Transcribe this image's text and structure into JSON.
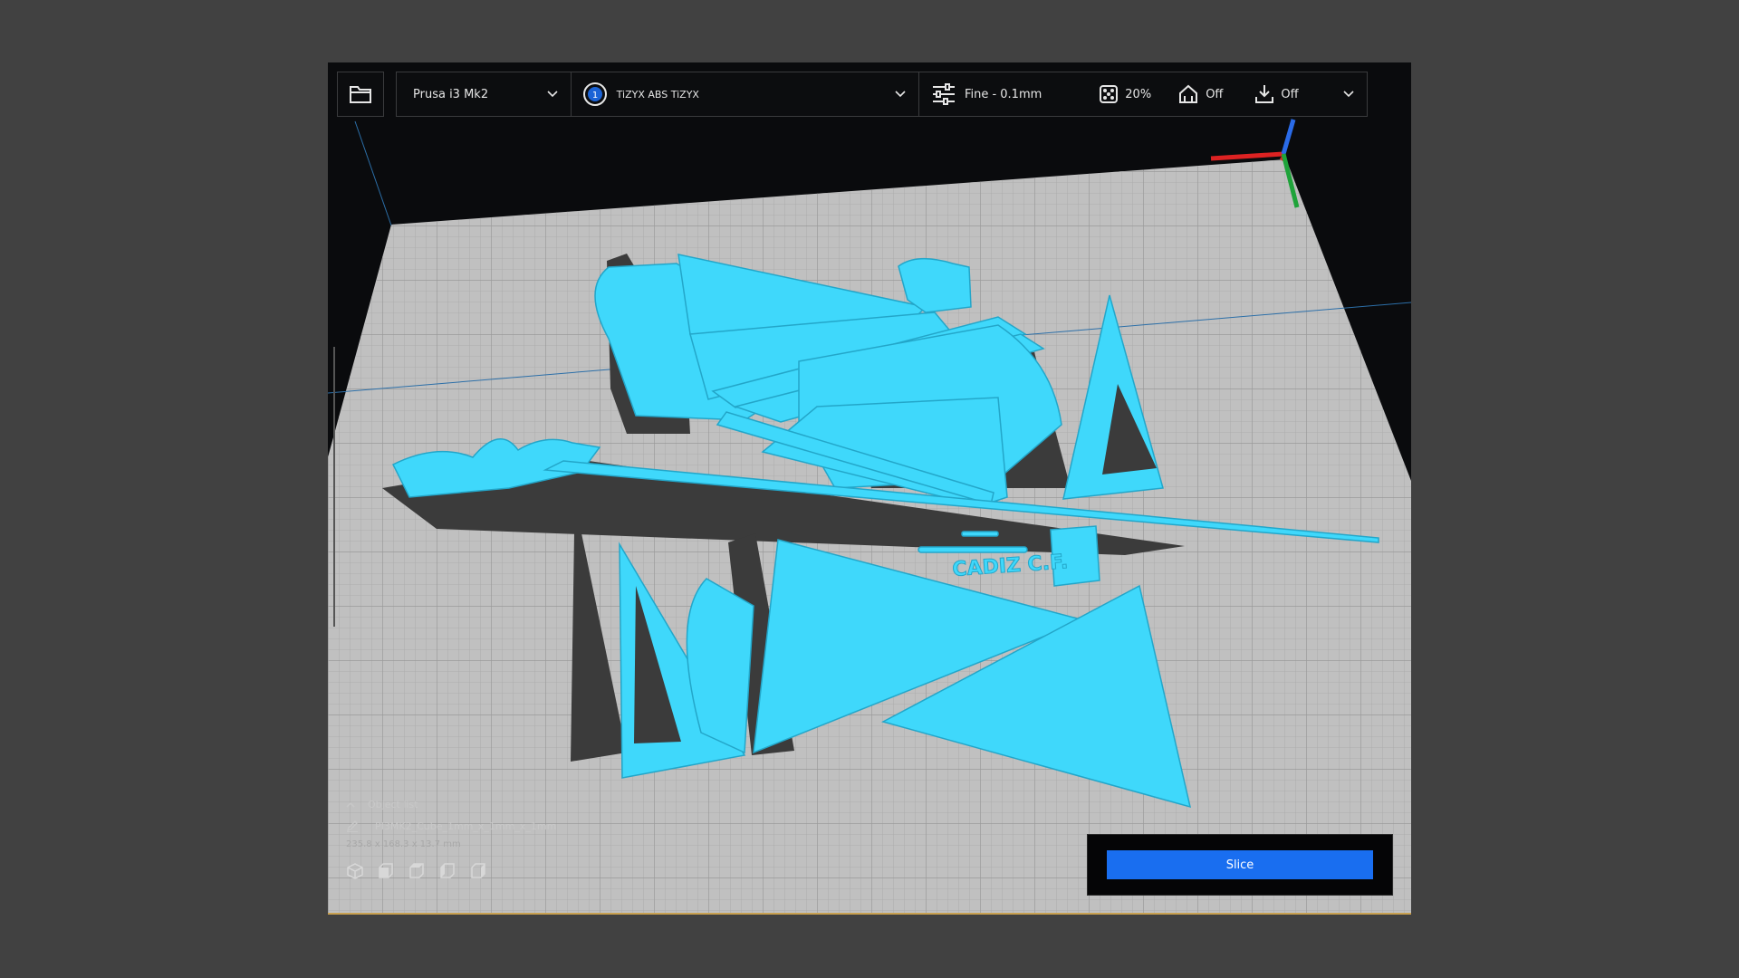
{
  "toolbar": {
    "printer": "Prusa i3 Mk2",
    "material_badge": "1",
    "material": "TiZYX ABS TiZYX",
    "quality": "Fine - 0.1mm",
    "infill": "20%",
    "support": "Off",
    "adhesion": "Off"
  },
  "object_panel": {
    "header": "Object list",
    "object_name": "PI3MK2_Cube_1mm_x_1mm_x_1mm",
    "dimensions": "235.8 x 168.3 x 13.7 mm"
  },
  "scene_label": "CADIZ C.F.",
  "slice": {
    "button_label": "Slice"
  },
  "colors": {
    "model": "#3fd8fb",
    "bed": "#c0c0c0",
    "accent": "#196ef0",
    "background": "#414141"
  }
}
